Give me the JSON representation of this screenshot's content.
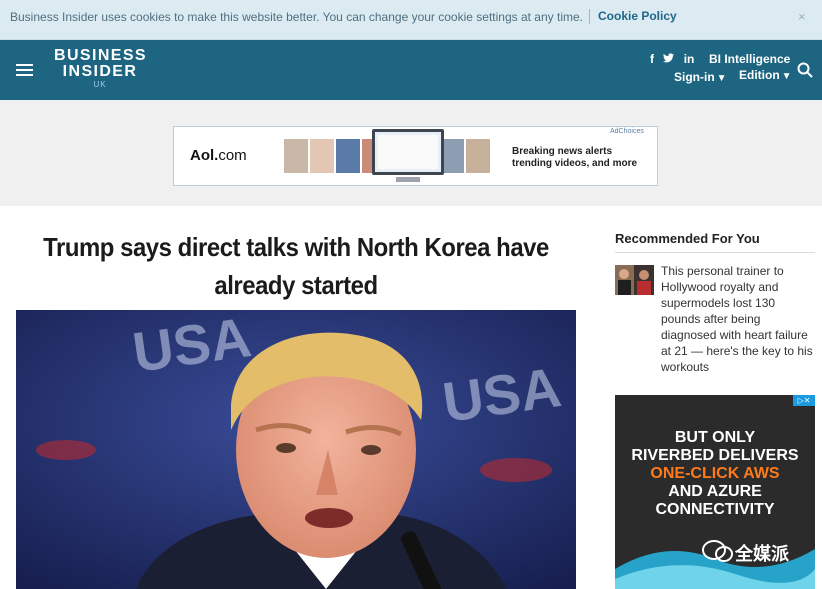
{
  "cookie": {
    "text": "Business Insider uses cookies to make this website better. You can change your cookie settings at any time.",
    "policy_link": "Cookie Policy",
    "close": "×"
  },
  "header": {
    "logo_line1": "BUSINESS",
    "logo_line2": "INSIDER",
    "logo_sub": "UK",
    "social": [
      "f",
      "t",
      "in"
    ],
    "bi_intelligence": "BI Intelligence",
    "signin": "Sign-in",
    "edition": "Edition"
  },
  "banner_ad": {
    "brand": "Aol.",
    "brand_suffix": "com",
    "line1": "Breaking news alerts",
    "line2": "trending videos, and more",
    "adchoices": "AdChoices"
  },
  "article": {
    "title": "Trump says direct talks with North Korea have already started",
    "hero_text": "USA"
  },
  "sidebar": {
    "recommended_title": "Recommended For You",
    "items": [
      {
        "text": "This personal trainer to Hollywood royalty and supermodels lost 130 pounds after being diagnosed with heart failure at 21 — here's the key to his workouts"
      }
    ],
    "ad": {
      "line1": "BUT ONLY",
      "line2": "RIVERBED DELIVERS",
      "line3": "ONE-CLICK AWS",
      "line4": "AND AZURE",
      "line5": "CONNECTIVITY",
      "close": "▷✕"
    },
    "watermark": "全媒派"
  },
  "colors": {
    "cookie_bg": "#dcebf2",
    "header_bg": "#1d6580",
    "ad_accent": "#ff7a1a"
  }
}
